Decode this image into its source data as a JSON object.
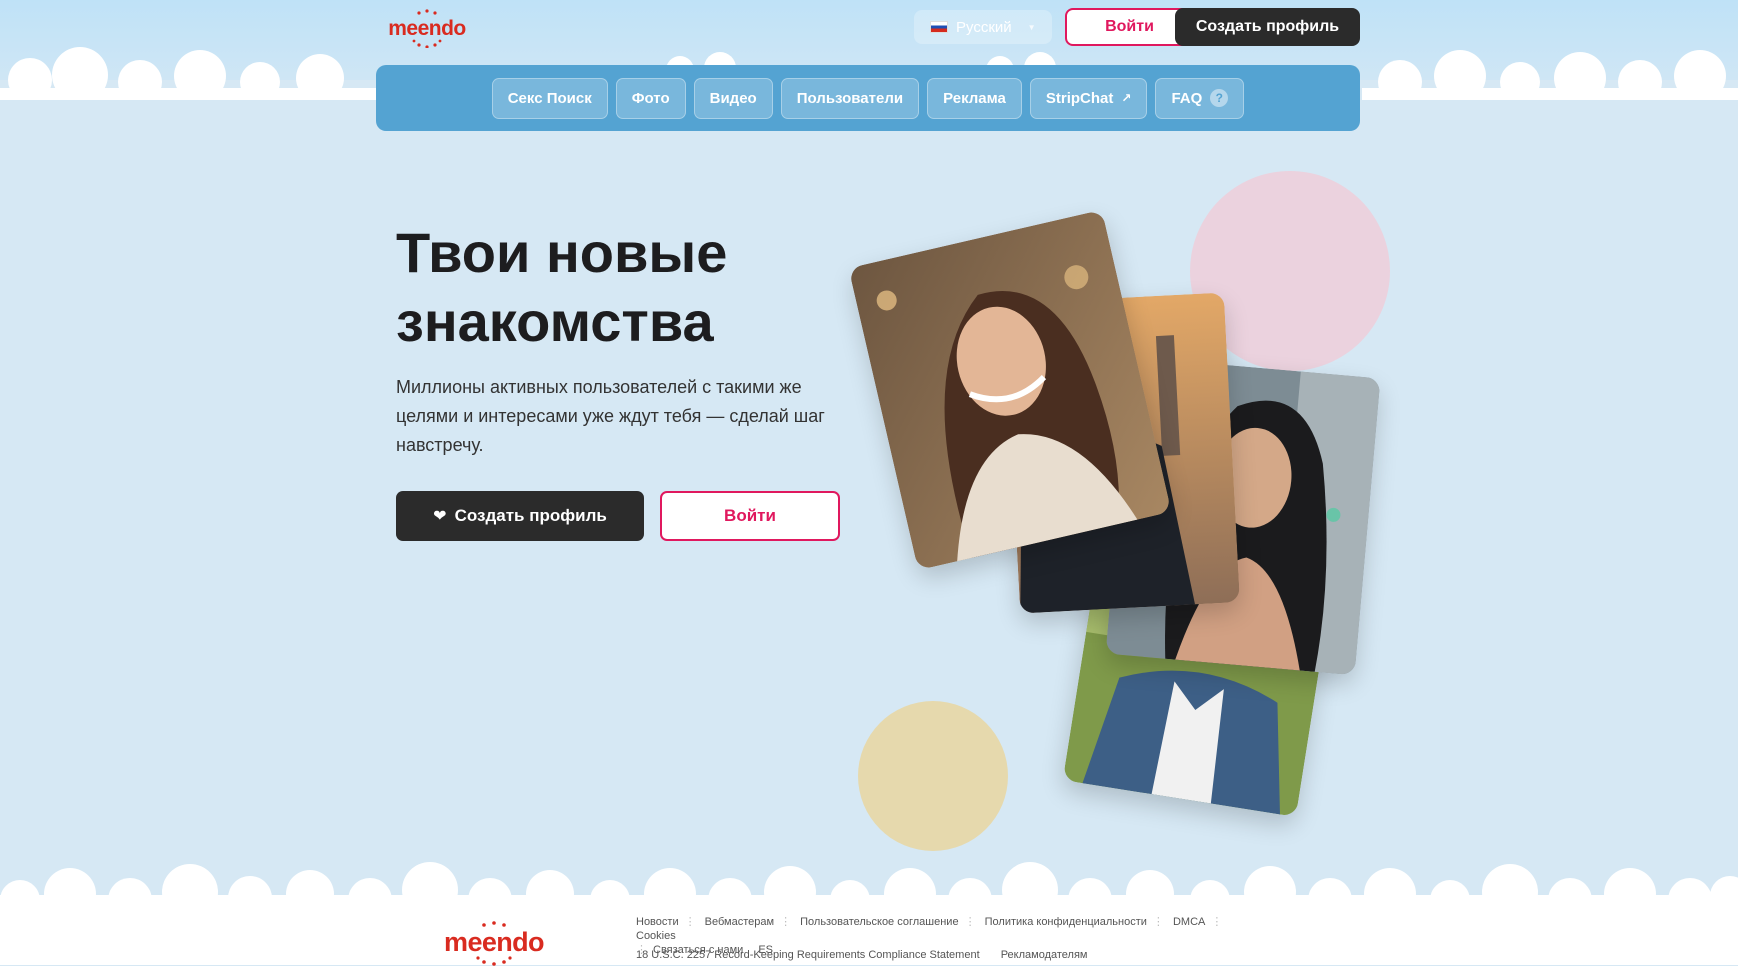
{
  "header": {
    "logo_text": "meendo",
    "language": "Русский",
    "login_label": "Войти",
    "create_profile_label": "Создать профиль"
  },
  "nav": {
    "items": [
      {
        "label": "Секс Поиск"
      },
      {
        "label": "Фото"
      },
      {
        "label": "Видео"
      },
      {
        "label": "Пользователи"
      },
      {
        "label": "Реклама"
      },
      {
        "label": "StripChat"
      },
      {
        "label": "FAQ"
      }
    ]
  },
  "hero": {
    "title_line1": "Твои новые",
    "title_line2": "знакомства",
    "subtitle": "Миллионы активных пользователей с такими же целями и интересами уже ждут тебя — сделай шаг навстречу.",
    "create_profile_label": "Создать профиль",
    "login_label": "Войти"
  },
  "footer": {
    "logo_text": "meendo",
    "links": [
      "Новости",
      "Вебмастерам",
      "Пользовательское соглашение",
      "Политика конфиденциальности",
      "DMCA",
      "Cookies",
      "Связаться с нами"
    ],
    "language_code": "ES",
    "compliance": "18 U.S.C. 2257 Record-Keeping Requirements Compliance Statement",
    "advertisers": "Рекламодателям"
  },
  "colors": {
    "accent": "#e0185e",
    "nav_bg": "#54a3d2",
    "dark_button": "#2b2b2b",
    "page_bg": "#d6e8f4",
    "logo_red": "#d92b20"
  },
  "icons": [
    "flag-russia-icon",
    "chevron-down-icon",
    "external-link-icon",
    "help-icon",
    "heart-icon"
  ]
}
